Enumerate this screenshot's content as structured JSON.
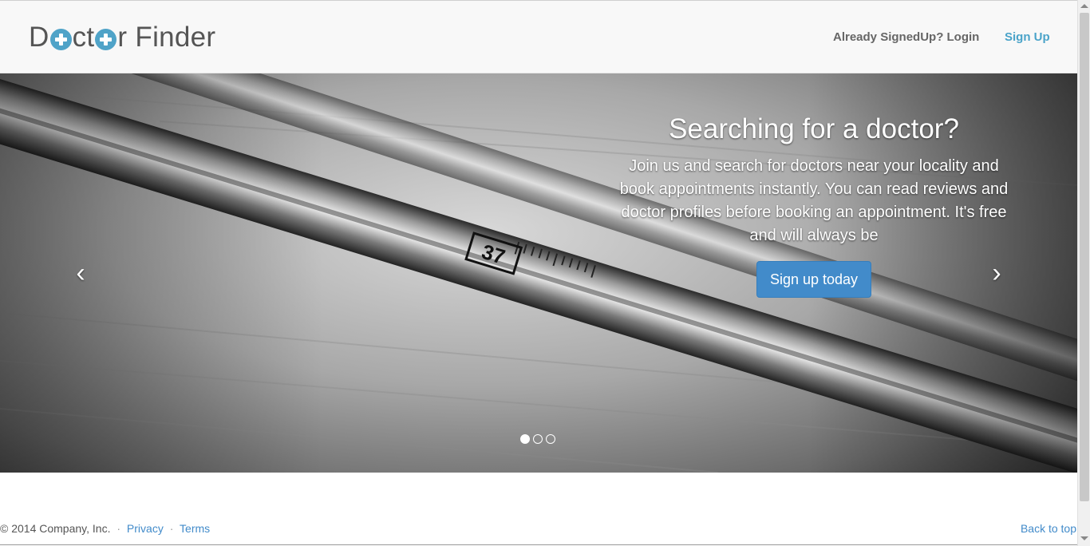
{
  "navbar": {
    "brand_part1": "D",
    "brand_part2": "ct",
    "brand_part3": "r Finder",
    "login_label": "Already  SignedUp? Login",
    "signup_label": "Sign Up"
  },
  "carousel": {
    "heading": "Searching for a doctor?",
    "body": "Join us and search for doctors near your locality and book appointments instantly. You can read reviews and doctor profiles before booking an appointment. It's free and will always be",
    "cta_label": "Sign up today",
    "prev_icon": "‹",
    "next_icon": "›",
    "slides_total": 3,
    "active_slide": 1,
    "image_text": "37"
  },
  "footer": {
    "copyright": "© 2014 Company, Inc.",
    "privacy_label": "Privacy",
    "terms_label": "Terms",
    "back_to_top_label": "Back to top"
  },
  "colors": {
    "accent": "#4fa3c8",
    "button": "#428bca",
    "link": "#428bca"
  }
}
